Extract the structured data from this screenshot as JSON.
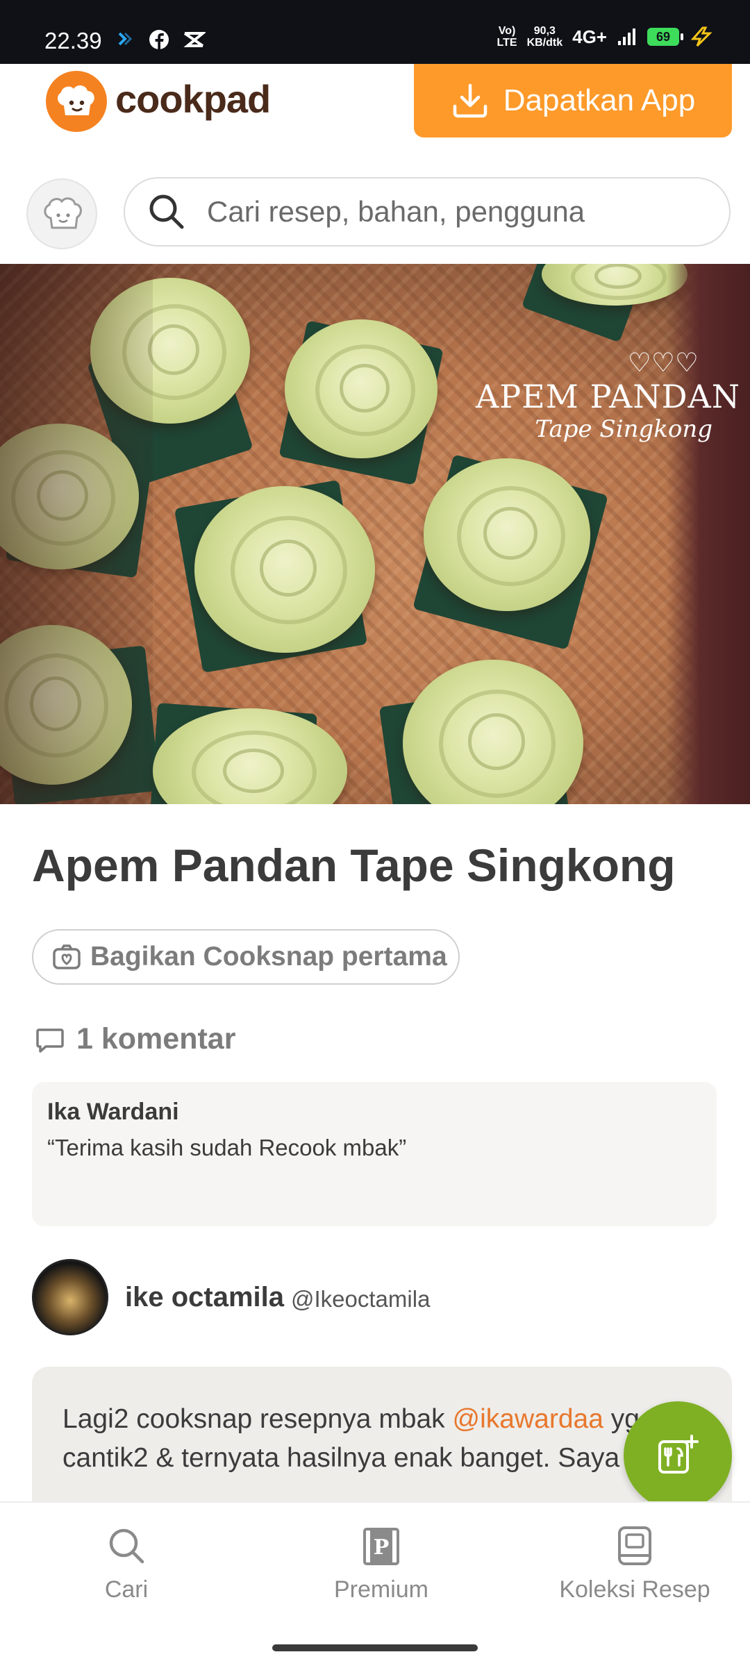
{
  "status_bar": {
    "time": "22.39",
    "network_type": "VoLTE",
    "speed": "90,3",
    "speed_unit": "KB/dtk",
    "signal": "4G+",
    "battery": "69",
    "icons": [
      "notification-icon",
      "facebook-icon",
      "capcut-icon",
      "signal-icon",
      "charging-icon"
    ]
  },
  "header": {
    "logo_text": "cookpad",
    "get_app_label": "Dapatkan App"
  },
  "search": {
    "placeholder": "Cari resep, bahan, pengguna"
  },
  "hero": {
    "watermark_hearts": "♡♡♡",
    "watermark_title": "APEM PANDAN",
    "watermark_subtitle": "Tape Singkong"
  },
  "recipe": {
    "title": "Apem Pandan Tape Singkong",
    "cooksnap_label": "Bagikan Cooksnap pertama",
    "comments_label": "1 komentar"
  },
  "comment": {
    "author": "Ika Wardani",
    "text": "“Terima kasih sudah Recook mbak”"
  },
  "author": {
    "name": "ike octamila",
    "handle": "@Ikeoctamila"
  },
  "story": {
    "text_before": "Lagi2 cooksnap resepnya mbak ",
    "mention": "@ikawardaa",
    "text_after": " yg cantik2 & ternyata hasilnya enak banget. Saya"
  },
  "bottom_nav": {
    "items": [
      {
        "label": "Cari",
        "icon": "search-icon"
      },
      {
        "label": "Premium",
        "icon": "premium-icon"
      },
      {
        "label": "Koleksi Resep",
        "icon": "collection-icon"
      }
    ]
  },
  "colors": {
    "brand_orange": "#fd9a2a",
    "fab_green": "#7fb024",
    "mention_orange": "#e8772c"
  }
}
